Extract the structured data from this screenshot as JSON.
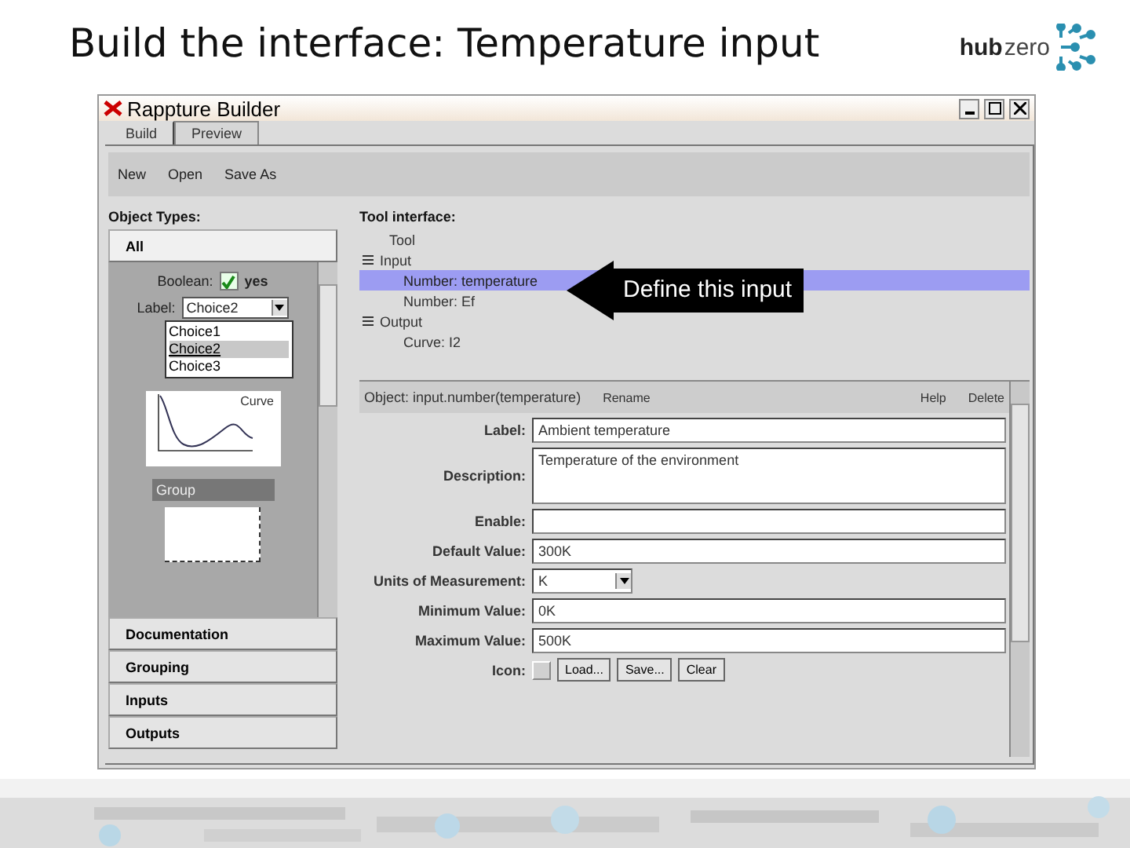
{
  "slide": {
    "title": "Build the interface:  Temperature input",
    "logo": {
      "part_1": "hub",
      "part_2": "zero"
    }
  },
  "window": {
    "title": "Rappture Builder"
  },
  "tabs": [
    {
      "label": "Build",
      "selected": true
    },
    {
      "label": "Preview",
      "selected": false
    }
  ],
  "toolbar": [
    "New",
    "Open",
    "Save As"
  ],
  "object_types": {
    "heading": "Object Types:",
    "sections": [
      {
        "label": "All",
        "expanded": true
      },
      {
        "label": "Documentation",
        "expanded": false
      },
      {
        "label": "Grouping",
        "expanded": false
      },
      {
        "label": "Inputs",
        "expanded": false
      },
      {
        "label": "Outputs",
        "expanded": false
      }
    ],
    "palette": {
      "boolean_label": "Boolean:",
      "boolean_checked": true,
      "boolean_value": "yes",
      "choice_label": "Label:",
      "choice_value": "Choice2",
      "choice_options": [
        {
          "label": "Choice1",
          "selected": false
        },
        {
          "label": "Choice2",
          "selected": true
        },
        {
          "label": "Choice3",
          "selected": false
        }
      ],
      "curve_label": "Curve",
      "group_label": "Group"
    }
  },
  "tool_interface": {
    "heading": "Tool interface:",
    "tree": [
      {
        "label": "Tool",
        "selected": false
      },
      {
        "label": "Input",
        "selected": false,
        "children": [
          {
            "label": "Number: temperature",
            "selected": true
          },
          {
            "label": "Number: Ef",
            "selected": false
          }
        ]
      },
      {
        "label": "Output",
        "selected": false,
        "children": [
          {
            "label": "Curve: I2",
            "selected": false
          }
        ]
      }
    ],
    "callout": "Define this input"
  },
  "object_panel": {
    "object": "Object: input.number(temperature)",
    "actions": [
      "Rename",
      "Help",
      "Delete"
    ],
    "fields": [
      {
        "kind": "text",
        "label": "Label:",
        "value": "Ambient temperature"
      },
      {
        "kind": "textarea",
        "label": "Description:",
        "value": "Temperature of the environment"
      },
      {
        "kind": "text",
        "label": "Enable:"
      },
      {
        "kind": "text",
        "label": "Default Value:",
        "value": "300K"
      },
      {
        "kind": "select",
        "label": "Units of Measurement:",
        "value": "K"
      },
      {
        "kind": "text",
        "label": "Minimum Value:",
        "value": "0K"
      },
      {
        "kind": "text",
        "label": "Maximum Value:",
        "value": "500K"
      },
      {
        "kind": "icon",
        "label": "Icon:",
        "buttons": [
          "Load...",
          "Save...",
          "Clear"
        ]
      }
    ]
  }
}
